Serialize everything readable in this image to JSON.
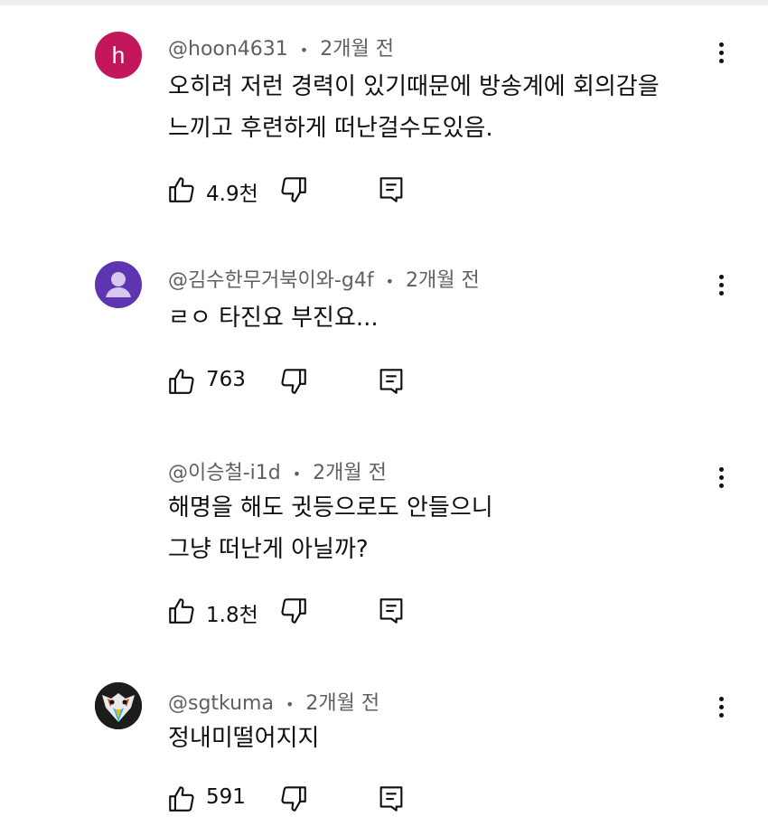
{
  "comments": [
    {
      "author": "@hoon4631",
      "sep": "•",
      "time": "2개월 전",
      "avatar_letter": "h",
      "avatar_color": "#c2185b",
      "lines": [
        "오히려 저런 경력이 있기때문에 방송계에 회의감을",
        "느끼고 후련하게 떠난걸수도있음."
      ],
      "likes": "4.9천"
    },
    {
      "author": "@김수한무거북이와-g4f",
      "sep": "•",
      "time": "2개월 전",
      "avatar_color": "#5e35b1",
      "lines": [
        "ㄹㅇ 타진요 부진요..."
      ],
      "likes": "763"
    },
    {
      "author": "@이승철-i1d",
      "sep": "•",
      "time": "2개월 전",
      "lines": [
        "해명을 해도 귓등으로도 안들으니",
        "그냥 떠난게 아닐까?"
      ],
      "likes": "1.8천"
    },
    {
      "author": "@sgtkuma",
      "sep": "•",
      "time": "2개월 전",
      "lines": [
        "정내미떨어지지"
      ],
      "likes": "591"
    }
  ]
}
